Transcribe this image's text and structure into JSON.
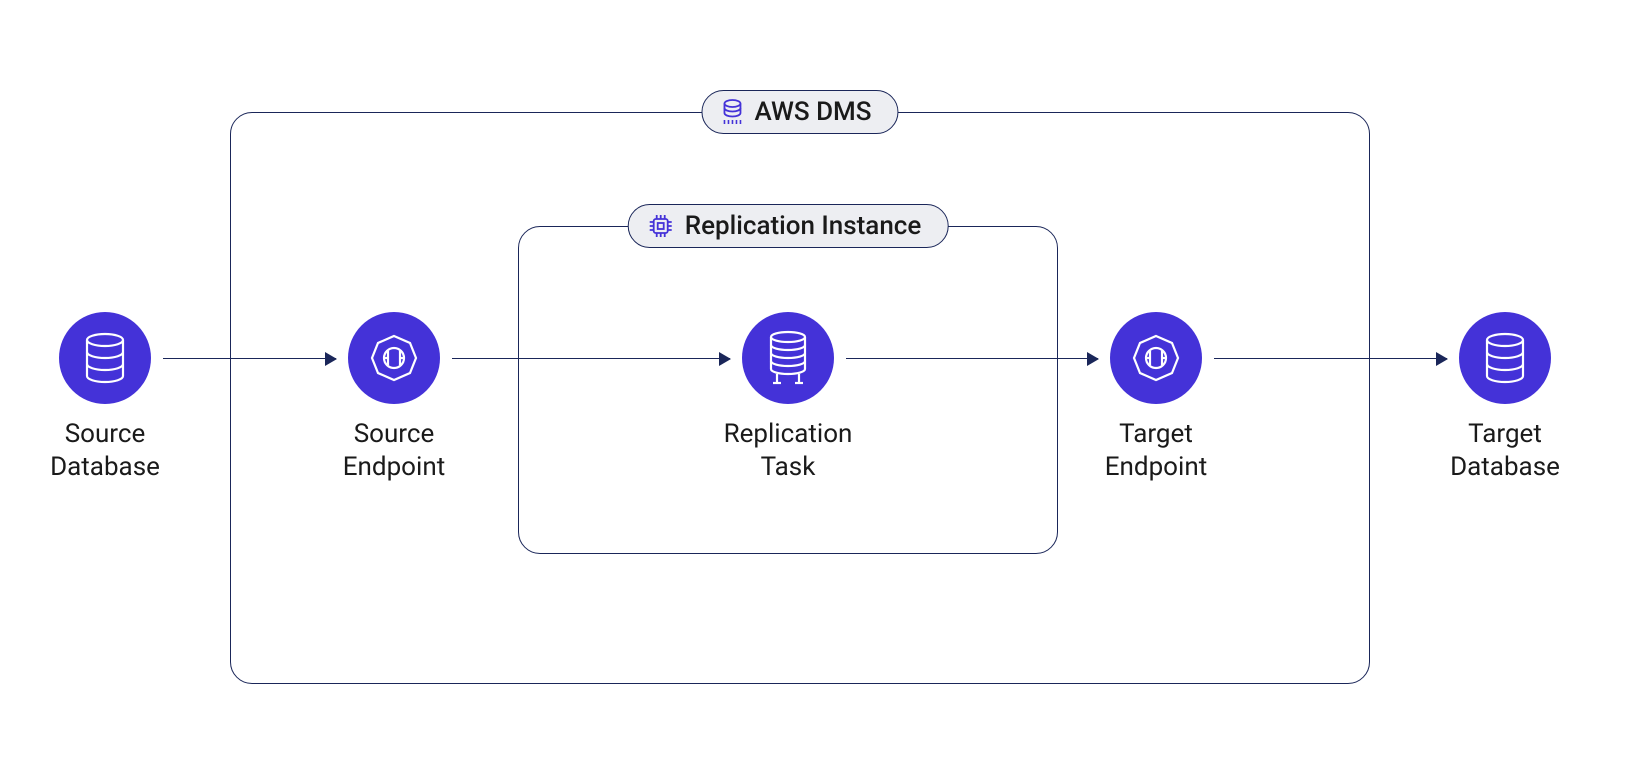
{
  "containers": {
    "outer_label": "AWS DMS",
    "inner_label": "Replication Instance"
  },
  "nodes": {
    "source_db": {
      "label_l1": "Source",
      "label_l2": "Database"
    },
    "source_endpoint": {
      "label_l1": "Source",
      "label_l2": "Endpoint"
    },
    "replication_task": {
      "label_l1": "Replication",
      "label_l2": "Task"
    },
    "target_endpoint": {
      "label_l1": "Target",
      "label_l2": "Endpoint"
    },
    "target_db": {
      "label_l1": "Target",
      "label_l2": "Database"
    }
  },
  "icons": {
    "outer_pill": "dms-service-icon",
    "inner_pill": "chip-icon",
    "source_db": "database-icon",
    "source_endpoint": "endpoint-icon",
    "replication_task": "server-stack-icon",
    "target_endpoint": "endpoint-icon",
    "target_db": "database-icon"
  }
}
